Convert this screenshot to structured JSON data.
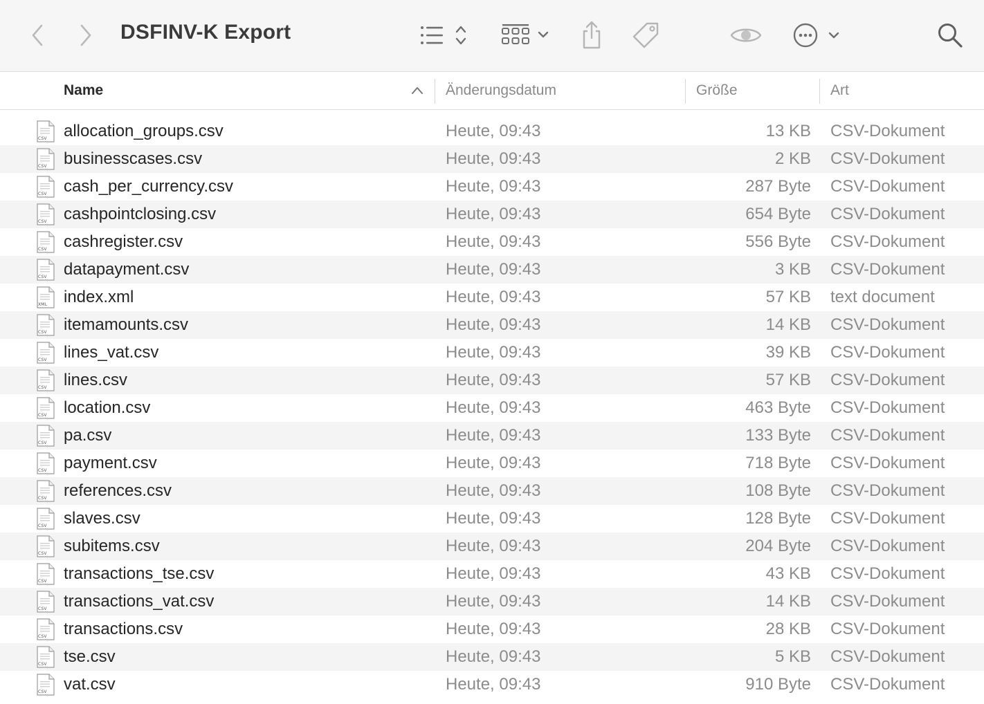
{
  "window": {
    "title": "DSFINV-K Export"
  },
  "toolbar": {
    "icons": [
      "chevron-left-icon",
      "chevron-right-icon",
      "list-view-icon",
      "group-icon",
      "share-icon",
      "tag-icon",
      "quicklook-icon",
      "more-icon",
      "search-icon"
    ]
  },
  "columns": {
    "name": "Name",
    "date": "Änderungsdatum",
    "size": "Größe",
    "kind": "Art"
  },
  "files": [
    {
      "name": "allocation_groups.csv",
      "date": "Heute, 09:43",
      "size": "13 KB",
      "kind": "CSV-Dokument",
      "badge": "CSV"
    },
    {
      "name": "businesscases.csv",
      "date": "Heute, 09:43",
      "size": "2 KB",
      "kind": "CSV-Dokument",
      "badge": "CSV"
    },
    {
      "name": "cash_per_currency.csv",
      "date": "Heute, 09:43",
      "size": "287 Byte",
      "kind": "CSV-Dokument",
      "badge": "CSV"
    },
    {
      "name": "cashpointclosing.csv",
      "date": "Heute, 09:43",
      "size": "654 Byte",
      "kind": "CSV-Dokument",
      "badge": "CSV"
    },
    {
      "name": "cashregister.csv",
      "date": "Heute, 09:43",
      "size": "556 Byte",
      "kind": "CSV-Dokument",
      "badge": "CSV"
    },
    {
      "name": "datapayment.csv",
      "date": "Heute, 09:43",
      "size": "3 KB",
      "kind": "CSV-Dokument",
      "badge": "CSV"
    },
    {
      "name": "index.xml",
      "date": "Heute, 09:43",
      "size": "57 KB",
      "kind": "text document",
      "badge": "XML"
    },
    {
      "name": "itemamounts.csv",
      "date": "Heute, 09:43",
      "size": "14 KB",
      "kind": "CSV-Dokument",
      "badge": "CSV"
    },
    {
      "name": "lines_vat.csv",
      "date": "Heute, 09:43",
      "size": "39 KB",
      "kind": "CSV-Dokument",
      "badge": "CSV"
    },
    {
      "name": "lines.csv",
      "date": "Heute, 09:43",
      "size": "57 KB",
      "kind": "CSV-Dokument",
      "badge": "CSV"
    },
    {
      "name": "location.csv",
      "date": "Heute, 09:43",
      "size": "463 Byte",
      "kind": "CSV-Dokument",
      "badge": "CSV"
    },
    {
      "name": "pa.csv",
      "date": "Heute, 09:43",
      "size": "133 Byte",
      "kind": "CSV-Dokument",
      "badge": "CSV"
    },
    {
      "name": "payment.csv",
      "date": "Heute, 09:43",
      "size": "718 Byte",
      "kind": "CSV-Dokument",
      "badge": "CSV"
    },
    {
      "name": "references.csv",
      "date": "Heute, 09:43",
      "size": "108 Byte",
      "kind": "CSV-Dokument",
      "badge": "CSV"
    },
    {
      "name": "slaves.csv",
      "date": "Heute, 09:43",
      "size": "128 Byte",
      "kind": "CSV-Dokument",
      "badge": "CSV"
    },
    {
      "name": "subitems.csv",
      "date": "Heute, 09:43",
      "size": "204 Byte",
      "kind": "CSV-Dokument",
      "badge": "CSV"
    },
    {
      "name": "transactions_tse.csv",
      "date": "Heute, 09:43",
      "size": "43 KB",
      "kind": "CSV-Dokument",
      "badge": "CSV"
    },
    {
      "name": "transactions_vat.csv",
      "date": "Heute, 09:43",
      "size": "14 KB",
      "kind": "CSV-Dokument",
      "badge": "CSV"
    },
    {
      "name": "transactions.csv",
      "date": "Heute, 09:43",
      "size": "28 KB",
      "kind": "CSV-Dokument",
      "badge": "CSV"
    },
    {
      "name": "tse.csv",
      "date": "Heute, 09:43",
      "size": "5 KB",
      "kind": "CSV-Dokument",
      "badge": "CSV"
    },
    {
      "name": "vat.csv",
      "date": "Heute, 09:43",
      "size": "910 Byte",
      "kind": "CSV-Dokument",
      "badge": "CSV"
    }
  ]
}
